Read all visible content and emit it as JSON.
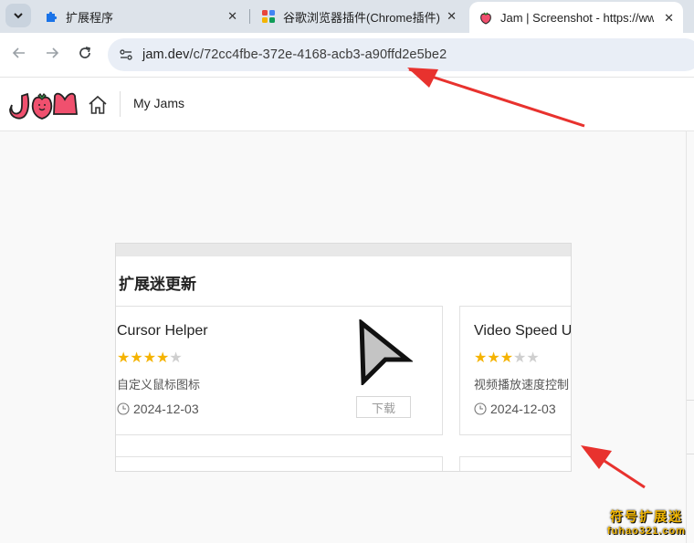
{
  "browser": {
    "tabs": [
      {
        "title": "扩展程序",
        "icon": "puzzle-icon"
      },
      {
        "title": "谷歌浏览器插件(Chrome插件)-",
        "icon": "apps-grid-icon"
      },
      {
        "title": "Jam | Screenshot - https://ww",
        "icon": "jam-strawberry-icon"
      }
    ],
    "active_tab": 2,
    "url_host": "jam.dev",
    "url_path": "/c/72cc4fbe-372e-4168-acb3-a90ffd2e5be2"
  },
  "jam_header": {
    "logo_icon": "jam-logo-icon",
    "my_jams": "My Jams"
  },
  "screenshot": {
    "section_title": "扩展迷更新",
    "cards": [
      {
        "name": "Cursor Helper",
        "rating": 4,
        "max_rating": 5,
        "desc": "自定义鼠标图标",
        "date": "2024-12-03",
        "download": "下载",
        "icon": "cursor-arrow-icon"
      },
      {
        "name": "Video Speed U",
        "rating": 3,
        "max_rating": 5,
        "desc": "视频播放速度控制",
        "date": "2024-12-03"
      }
    ]
  },
  "watermark": {
    "line1": "符号扩展迷",
    "line2": "fuhao321.com"
  },
  "colors": {
    "arrow": "#e8322e",
    "star_on": "#f5b301",
    "star_off": "#cfcfcf",
    "jam_pink": "#f0506e"
  }
}
